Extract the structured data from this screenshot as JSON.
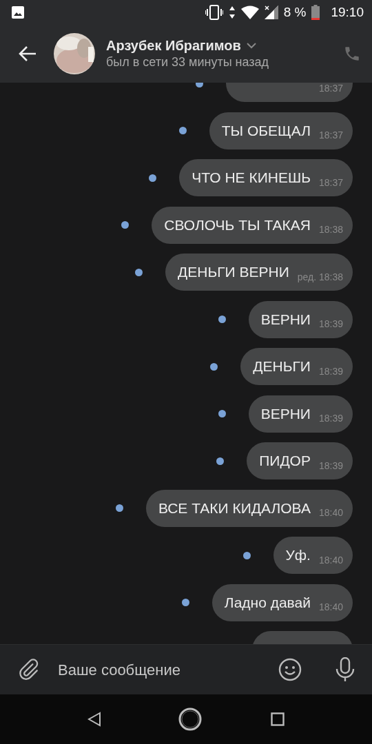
{
  "status_bar": {
    "battery": "8 %",
    "time": "19:10"
  },
  "header": {
    "name": "Арзубек Ибрагимов",
    "status": "был в сети 33 минуты назад"
  },
  "messages": [
    {
      "kind": "cut",
      "time": "18:37",
      "unread": true
    },
    {
      "kind": "text",
      "text": "ТЫ ОБЕЩАЛ",
      "time": "18:37",
      "unread": true
    },
    {
      "kind": "text",
      "text": "ЧТО НЕ КИНЕШЬ",
      "time": "18:37",
      "unread": true
    },
    {
      "kind": "text",
      "text": "СВОЛОЧЬ ТЫ ТАКАЯ",
      "time": "18:38",
      "unread": true
    },
    {
      "kind": "text",
      "text": "ДЕНЬГИ ВЕРНИ",
      "time": "ред. 18:38",
      "unread": true
    },
    {
      "kind": "text",
      "text": "ВЕРНИ",
      "time": "18:39",
      "unread": true
    },
    {
      "kind": "text",
      "text": "ДЕНЬГИ",
      "time": "18:39",
      "unread": true
    },
    {
      "kind": "text",
      "text": "ВЕРНИ",
      "time": "18:39",
      "unread": true
    },
    {
      "kind": "text",
      "text": "ПИДОР",
      "time": "18:39",
      "unread": true
    },
    {
      "kind": "text",
      "text": "ВСЕ ТАКИ КИДАЛОВА",
      "time": "18:40",
      "unread": true
    },
    {
      "kind": "text",
      "text": "Уф.",
      "time": "18:40",
      "unread": true
    },
    {
      "kind": "text",
      "text": "Ладно давай",
      "time": "18:40",
      "unread": true
    },
    {
      "kind": "cut"
    }
  ],
  "composer": {
    "placeholder": "Ваше сообщение"
  }
}
